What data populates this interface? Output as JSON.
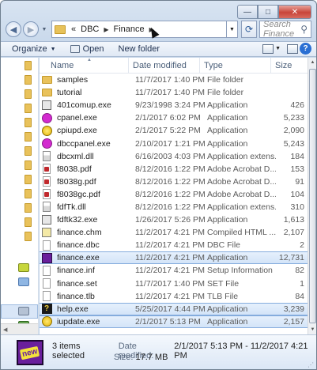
{
  "window": {
    "caption_minimize": "—",
    "caption_maximize": "□",
    "caption_close": "✕"
  },
  "address_bar": {
    "overflow": "«",
    "crumbs": [
      "DBC",
      "Finance"
    ],
    "search_placeholder": "Search Finance"
  },
  "toolbar": {
    "organize_label": "Organize",
    "open_label": "Open",
    "new_folder_label": "New folder"
  },
  "columns": {
    "name": "Name",
    "date": "Date modified",
    "type": "Type",
    "size": "Size"
  },
  "files": [
    {
      "name": "samples",
      "date": "11/7/2017 1:40 PM",
      "type": "File folder",
      "size": "",
      "icon": "folder-icon",
      "selected": false
    },
    {
      "name": "tutorial",
      "date": "11/7/2017 1:40 PM",
      "type": "File folder",
      "size": "",
      "icon": "folder-icon",
      "selected": false
    },
    {
      "name": "401comup.exe",
      "date": "9/23/1998 3:24 PM",
      "type": "Application",
      "size": "426",
      "icon": "application-icon",
      "selected": false
    },
    {
      "name": "cpanel.exe",
      "date": "2/1/2017 6:02 PM",
      "type": "Application",
      "size": "5,233",
      "icon": "magenta-app-icon",
      "selected": false
    },
    {
      "name": "cpiupd.exe",
      "date": "2/1/2017 5:22 PM",
      "type": "Application",
      "size": "2,090",
      "icon": "yellow-disc-icon",
      "selected": false
    },
    {
      "name": "dbccpanel.exe",
      "date": "2/10/2017 1:21 PM",
      "type": "Application",
      "size": "5,243",
      "icon": "magenta-app-icon",
      "selected": false
    },
    {
      "name": "dbcxml.dll",
      "date": "6/16/2003 4:03 PM",
      "type": "Application extens...",
      "size": "184",
      "icon": "dll-icon",
      "selected": false
    },
    {
      "name": "f8038.pdf",
      "date": "8/12/2016 1:22 PM",
      "type": "Adobe Acrobat D...",
      "size": "153",
      "icon": "pdf-icon",
      "selected": false
    },
    {
      "name": "f8038g.pdf",
      "date": "8/12/2016 1:22 PM",
      "type": "Adobe Acrobat D...",
      "size": "91",
      "icon": "pdf-icon",
      "selected": false
    },
    {
      "name": "f8038gc.pdf",
      "date": "8/12/2016 1:22 PM",
      "type": "Adobe Acrobat D...",
      "size": "104",
      "icon": "pdf-icon",
      "selected": false
    },
    {
      "name": "fdfTk.dll",
      "date": "8/12/2016 1:22 PM",
      "type": "Application extens...",
      "size": "310",
      "icon": "dll-icon",
      "selected": false
    },
    {
      "name": "fdftk32.exe",
      "date": "1/26/2017 5:26 PM",
      "type": "Application",
      "size": "1,613",
      "icon": "application-icon",
      "selected": false
    },
    {
      "name": "finance.chm",
      "date": "11/2/2017 4:21 PM",
      "type": "Compiled HTML ...",
      "size": "2,107",
      "icon": "help-file-icon",
      "selected": false
    },
    {
      "name": "finance.dbc",
      "date": "11/2/2017 4:21 PM",
      "type": "DBC File",
      "size": "2",
      "icon": "document-icon",
      "selected": false
    },
    {
      "name": "finance.exe",
      "date": "11/2/2017 4:21 PM",
      "type": "Application",
      "size": "12,731",
      "icon": "new-app-icon",
      "selected": true
    },
    {
      "name": "finance.inf",
      "date": "11/2/2017 4:21 PM",
      "type": "Setup Information",
      "size": "82",
      "icon": "document-icon",
      "selected": false
    },
    {
      "name": "finance.set",
      "date": "11/7/2017 1:40 PM",
      "type": "SET File",
      "size": "1",
      "icon": "document-icon",
      "selected": false
    },
    {
      "name": "finance.tlb",
      "date": "11/2/2017 4:21 PM",
      "type": "TLB File",
      "size": "84",
      "icon": "document-icon",
      "selected": false
    },
    {
      "name": "help.exe",
      "date": "5/25/2017 4:44 PM",
      "type": "Application",
      "size": "3,239",
      "icon": "help-app-icon",
      "selected": true
    },
    {
      "name": "iupdate.exe",
      "date": "2/1/2017 5:13 PM",
      "type": "Application",
      "size": "2,157",
      "icon": "yellow-disc-icon",
      "selected": true
    }
  ],
  "details": {
    "summary": "3 items selected",
    "date_label": "Date modified:",
    "date_value": "2/1/2017 5:13 PM - 11/2/2017 4:21 PM",
    "size_label": "Size:",
    "size_value": "17.7 MB",
    "icon_text": "new"
  }
}
